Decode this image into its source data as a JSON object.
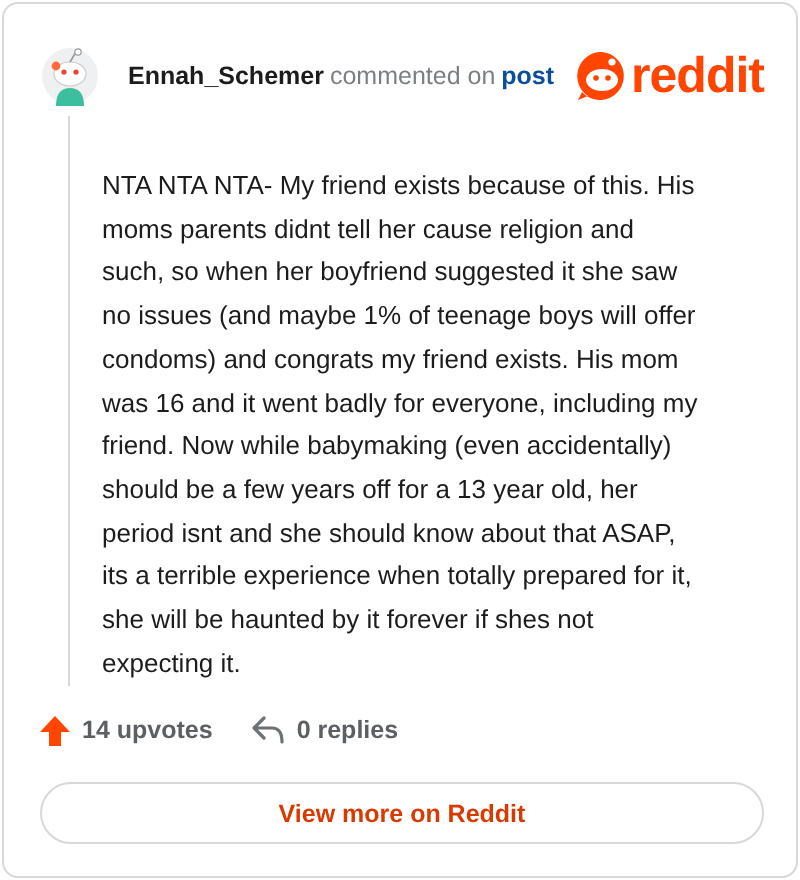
{
  "comment": {
    "author": "Ennah_Schemer",
    "action": "commented on",
    "link": "post",
    "body": "NTA NTA NTA- My friend exists because of this. His moms parents didnt tell her cause religion and such, so when her boyfriend suggested it she saw no issues (and maybe 1% of teenage boys will offer condoms) and congrats my friend exists. His mom was 16 and it went badly for everyone, including my friend. Now while babymaking (even accidentally) should be a few years off for a 13 year old, her period isnt and she should know about that ASAP, its a terrible experience when totally prepared for it, she will be haunted by it forever if shes not expecting it."
  },
  "logo": {
    "text": "reddit"
  },
  "footer": {
    "upvotes": "14 upvotes",
    "replies": "0 replies"
  },
  "button": {
    "label": "View more on Reddit"
  }
}
